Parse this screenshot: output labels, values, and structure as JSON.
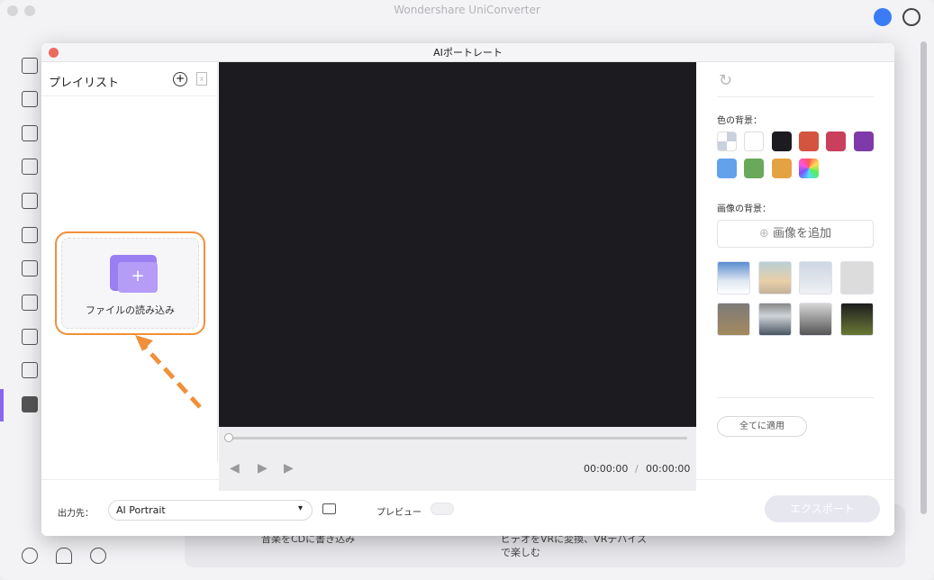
{
  "app": {
    "title": "Wondershare UniConverter"
  },
  "background": {
    "card1": "音楽をCDに書き込み",
    "card2a": "ビデオをVRに変換、VRデバイス",
    "card2b": "で楽しむ"
  },
  "dialog": {
    "title": "AIポートレート",
    "playlist": {
      "title": "プレイリスト",
      "add": "+",
      "delete": "x",
      "import_label": "ファイルの読み込み"
    },
    "player": {
      "current": "00:00:00",
      "separator": "/",
      "total": "00:00:00"
    },
    "settings": {
      "color_bg_label": "色の背景：",
      "colors": [
        "transparent",
        "#ffffff",
        "#1c1b20",
        "#d3553f",
        "#c93f5c",
        "#7f3aa9",
        "#63a2ea",
        "#6aa85c",
        "#e5a243",
        "rainbow"
      ],
      "image_bg_label": "画像の背景：",
      "add_image": "画像を追加",
      "apply_all": "全てに適用",
      "thumbnails": [
        "mountains",
        "beach",
        "white-room",
        "wall-decor",
        "lobby",
        "meeting-room",
        "office",
        "plants-night"
      ]
    },
    "footer": {
      "output_label": "出力先：",
      "output_value": "AI Portrait",
      "preview_label": "プレビュー",
      "export": "エクスポート"
    }
  }
}
